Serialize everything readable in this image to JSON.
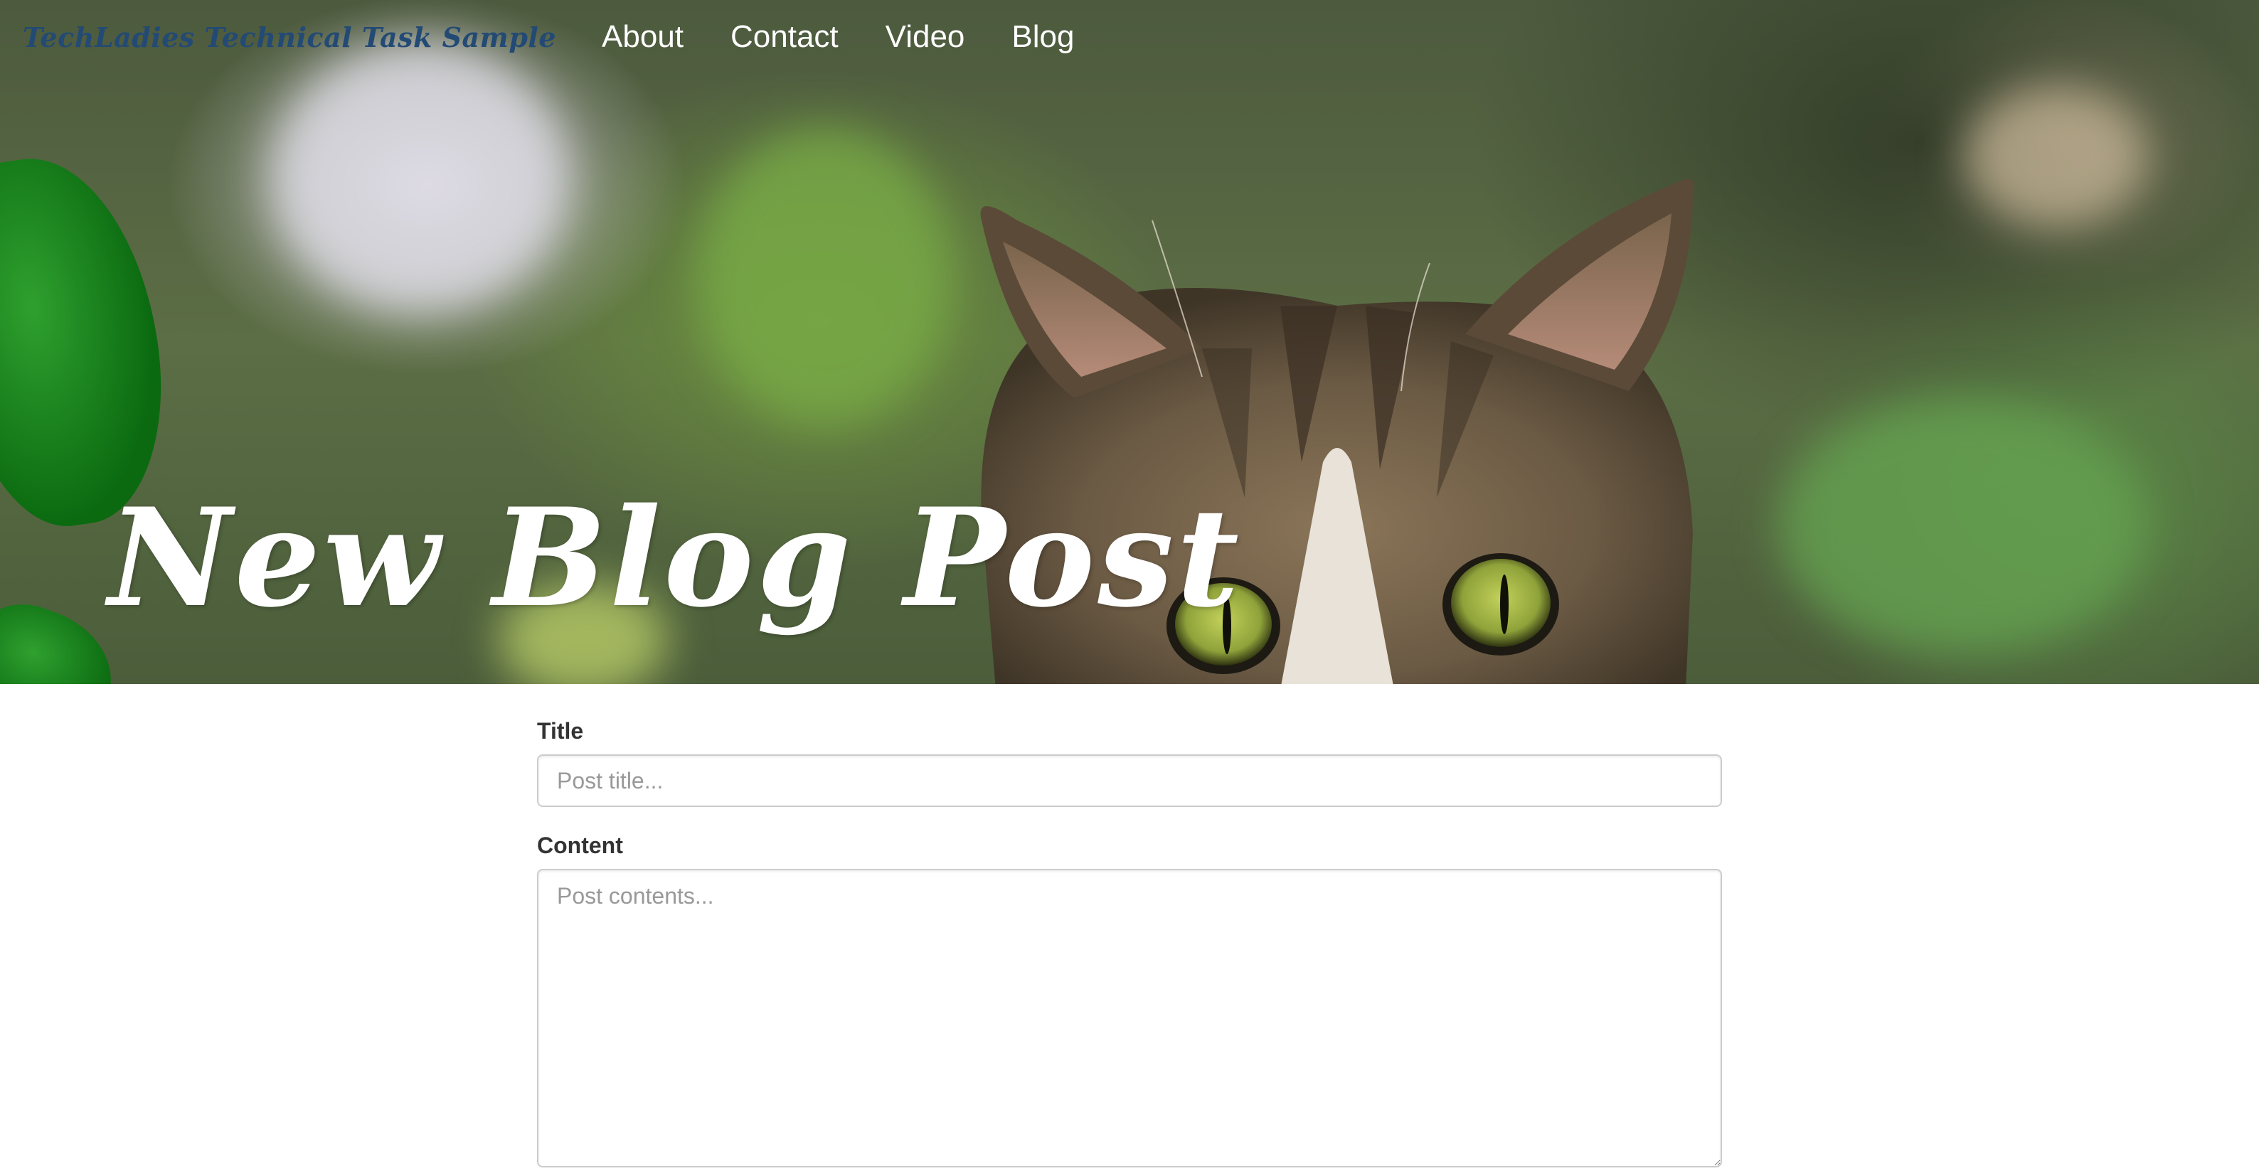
{
  "nav": {
    "brand": "TechLadies Technical Task Sample",
    "links": [
      {
        "label": "About"
      },
      {
        "label": "Contact"
      },
      {
        "label": "Video"
      },
      {
        "label": "Blog"
      }
    ]
  },
  "hero": {
    "title": "New Blog Post",
    "image": "cat-peeking-image"
  },
  "form": {
    "title_label": "Title",
    "title_placeholder": "Post title...",
    "title_value": "",
    "content_label": "Content",
    "content_placeholder": "Post contents...",
    "content_value": ""
  },
  "colors": {
    "brand": "#234a74",
    "nav_link": "#ffffff",
    "label": "#333333",
    "input_border": "#cccccc"
  }
}
